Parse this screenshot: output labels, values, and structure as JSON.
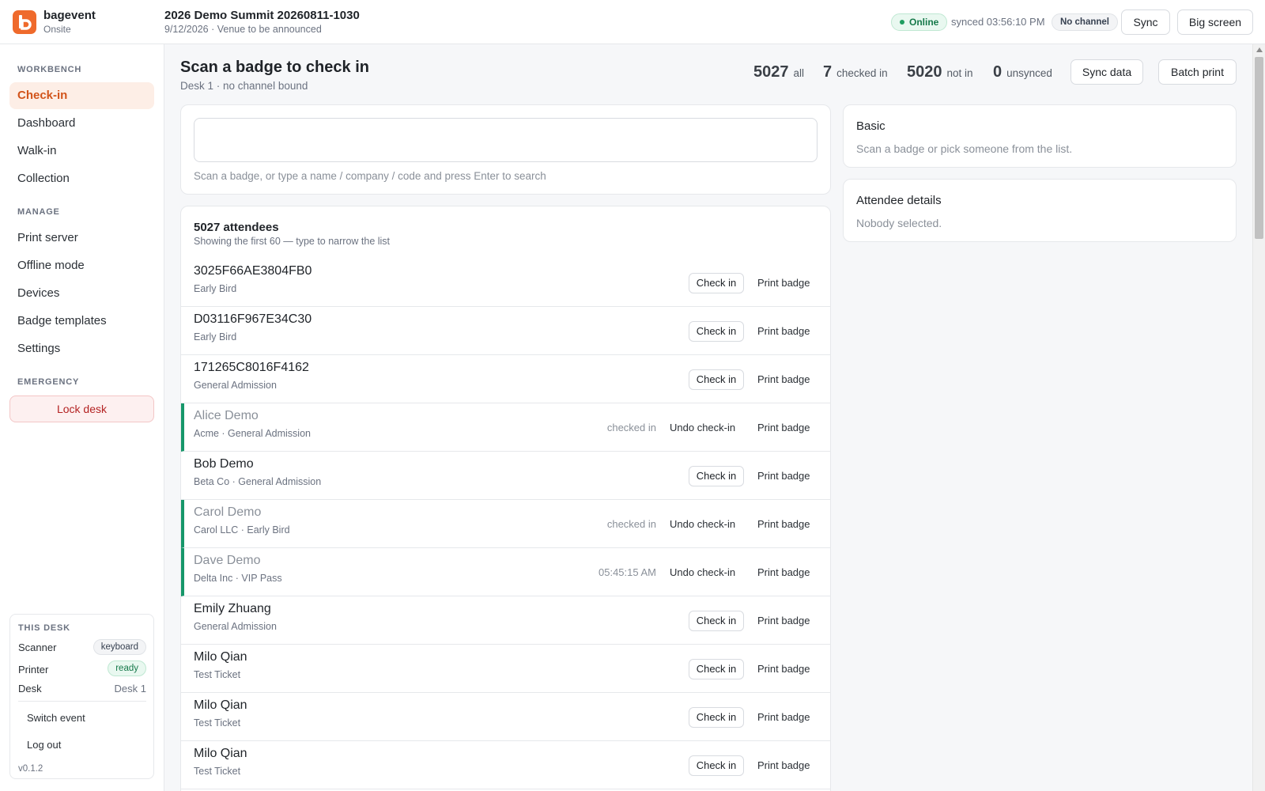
{
  "brand": {
    "name": "bagevent",
    "sub": "Onsite"
  },
  "event": {
    "title": "2026 Demo Summit 20260811-1030",
    "meta": "9/12/2026 · Venue to be announced"
  },
  "header": {
    "status": "Online",
    "synced": "synced 03:56:10 PM",
    "channel": "No channel",
    "sync_label": "Sync",
    "big_screen_label": "Big screen"
  },
  "sidebar": {
    "sections": [
      "WORKBENCH",
      "MANAGE",
      "EMERGENCY"
    ],
    "items": [
      {
        "label": "Check-in",
        "active": true
      },
      {
        "label": "Dashboard"
      },
      {
        "label": "Walk-in"
      },
      {
        "label": "Collection"
      },
      {
        "label": "Print server"
      },
      {
        "label": "Offline mode"
      },
      {
        "label": "Devices"
      },
      {
        "label": "Badge templates"
      },
      {
        "label": "Settings"
      }
    ],
    "lock_desk": "Lock desk",
    "desk": {
      "title": "THIS DESK",
      "scanner_label": "Scanner",
      "scanner_value": "keyboard",
      "printer_label": "Printer",
      "printer_value": "ready",
      "desk_label": "Desk",
      "desk_value": "Desk 1",
      "switch_event": "Switch event",
      "log_out": "Log out",
      "version": "v0.1.2"
    }
  },
  "main": {
    "title": "Scan a badge to check in",
    "subtitle": "Desk 1 · no channel bound",
    "stats": {
      "all_num": "5027",
      "all_label": "all",
      "checked_num": "7",
      "checked_label": "checked in",
      "notin_num": "5020",
      "notin_label": "not in",
      "unsynced_num": "0",
      "unsynced_label": "unsynced"
    },
    "sync_data_label": "Sync data",
    "batch_print_label": "Batch print",
    "search": {
      "value": "",
      "hint": "Scan a badge, or type a name / company / code and press Enter to search"
    },
    "list": {
      "title": "5027 attendees",
      "subtitle": "Showing the first 60 — type to narrow the list",
      "check_in_label": "Check in",
      "undo_label": "Undo check-in",
      "print_label": "Print badge",
      "rows": [
        {
          "name": "3025F66AE3804FB0",
          "sub": "Early Bird",
          "checked": false,
          "status": ""
        },
        {
          "name": "D03116F967E34C30",
          "sub": "Early Bird",
          "checked": false,
          "status": ""
        },
        {
          "name": "171265C8016F4162",
          "sub": "General Admission",
          "checked": false,
          "status": ""
        },
        {
          "name": "Alice Demo",
          "sub": "Acme · General Admission",
          "checked": true,
          "status": "checked in"
        },
        {
          "name": "Bob Demo",
          "sub": "Beta Co · General Admission",
          "checked": false,
          "status": ""
        },
        {
          "name": "Carol Demo",
          "sub": "Carol LLC · Early Bird",
          "checked": true,
          "status": "checked in"
        },
        {
          "name": "Dave Demo",
          "sub": "Delta Inc · VIP Pass",
          "checked": true,
          "status": "05:45:15 AM"
        },
        {
          "name": "Emily Zhuang",
          "sub": "General Admission",
          "checked": false,
          "status": ""
        },
        {
          "name": "Milo Qian",
          "sub": "Test Ticket",
          "checked": false,
          "status": ""
        },
        {
          "name": "Milo Qian",
          "sub": "Test Ticket",
          "checked": false,
          "status": ""
        },
        {
          "name": "Milo Qian",
          "sub": "Test Ticket",
          "checked": false,
          "status": ""
        }
      ]
    },
    "basic": {
      "title": "Basic",
      "text": "Scan a badge or pick someone from the list."
    },
    "details": {
      "title": "Attendee details",
      "text": "Nobody selected."
    }
  },
  "colors": {
    "accent": "#ef6a2c",
    "success": "#16976a",
    "danger": "#b42323"
  }
}
